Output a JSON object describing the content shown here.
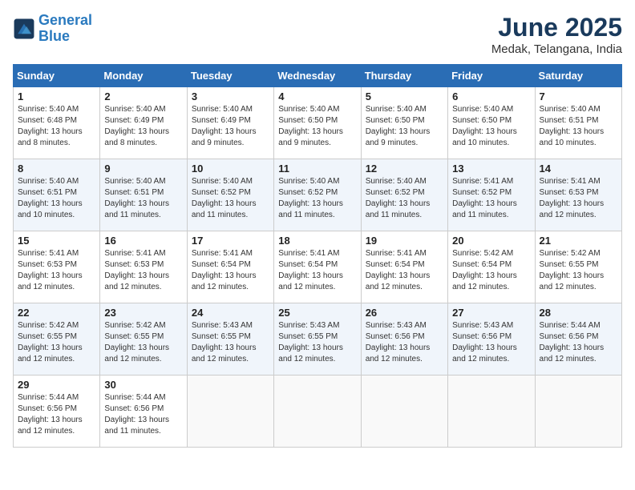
{
  "header": {
    "logo_line1": "General",
    "logo_line2": "Blue",
    "month": "June 2025",
    "location": "Medak, Telangana, India"
  },
  "weekdays": [
    "Sunday",
    "Monday",
    "Tuesday",
    "Wednesday",
    "Thursday",
    "Friday",
    "Saturday"
  ],
  "weeks": [
    [
      {
        "day": "1",
        "info": "Sunrise: 5:40 AM\nSunset: 6:48 PM\nDaylight: 13 hours\nand 8 minutes."
      },
      {
        "day": "2",
        "info": "Sunrise: 5:40 AM\nSunset: 6:49 PM\nDaylight: 13 hours\nand 8 minutes."
      },
      {
        "day": "3",
        "info": "Sunrise: 5:40 AM\nSunset: 6:49 PM\nDaylight: 13 hours\nand 9 minutes."
      },
      {
        "day": "4",
        "info": "Sunrise: 5:40 AM\nSunset: 6:50 PM\nDaylight: 13 hours\nand 9 minutes."
      },
      {
        "day": "5",
        "info": "Sunrise: 5:40 AM\nSunset: 6:50 PM\nDaylight: 13 hours\nand 9 minutes."
      },
      {
        "day": "6",
        "info": "Sunrise: 5:40 AM\nSunset: 6:50 PM\nDaylight: 13 hours\nand 10 minutes."
      },
      {
        "day": "7",
        "info": "Sunrise: 5:40 AM\nSunset: 6:51 PM\nDaylight: 13 hours\nand 10 minutes."
      }
    ],
    [
      {
        "day": "8",
        "info": "Sunrise: 5:40 AM\nSunset: 6:51 PM\nDaylight: 13 hours\nand 10 minutes."
      },
      {
        "day": "9",
        "info": "Sunrise: 5:40 AM\nSunset: 6:51 PM\nDaylight: 13 hours\nand 11 minutes."
      },
      {
        "day": "10",
        "info": "Sunrise: 5:40 AM\nSunset: 6:52 PM\nDaylight: 13 hours\nand 11 minutes."
      },
      {
        "day": "11",
        "info": "Sunrise: 5:40 AM\nSunset: 6:52 PM\nDaylight: 13 hours\nand 11 minutes."
      },
      {
        "day": "12",
        "info": "Sunrise: 5:40 AM\nSunset: 6:52 PM\nDaylight: 13 hours\nand 11 minutes."
      },
      {
        "day": "13",
        "info": "Sunrise: 5:41 AM\nSunset: 6:52 PM\nDaylight: 13 hours\nand 11 minutes."
      },
      {
        "day": "14",
        "info": "Sunrise: 5:41 AM\nSunset: 6:53 PM\nDaylight: 13 hours\nand 12 minutes."
      }
    ],
    [
      {
        "day": "15",
        "info": "Sunrise: 5:41 AM\nSunset: 6:53 PM\nDaylight: 13 hours\nand 12 minutes."
      },
      {
        "day": "16",
        "info": "Sunrise: 5:41 AM\nSunset: 6:53 PM\nDaylight: 13 hours\nand 12 minutes."
      },
      {
        "day": "17",
        "info": "Sunrise: 5:41 AM\nSunset: 6:54 PM\nDaylight: 13 hours\nand 12 minutes."
      },
      {
        "day": "18",
        "info": "Sunrise: 5:41 AM\nSunset: 6:54 PM\nDaylight: 13 hours\nand 12 minutes."
      },
      {
        "day": "19",
        "info": "Sunrise: 5:41 AM\nSunset: 6:54 PM\nDaylight: 13 hours\nand 12 minutes."
      },
      {
        "day": "20",
        "info": "Sunrise: 5:42 AM\nSunset: 6:54 PM\nDaylight: 13 hours\nand 12 minutes."
      },
      {
        "day": "21",
        "info": "Sunrise: 5:42 AM\nSunset: 6:55 PM\nDaylight: 13 hours\nand 12 minutes."
      }
    ],
    [
      {
        "day": "22",
        "info": "Sunrise: 5:42 AM\nSunset: 6:55 PM\nDaylight: 13 hours\nand 12 minutes."
      },
      {
        "day": "23",
        "info": "Sunrise: 5:42 AM\nSunset: 6:55 PM\nDaylight: 13 hours\nand 12 minutes."
      },
      {
        "day": "24",
        "info": "Sunrise: 5:43 AM\nSunset: 6:55 PM\nDaylight: 13 hours\nand 12 minutes."
      },
      {
        "day": "25",
        "info": "Sunrise: 5:43 AM\nSunset: 6:55 PM\nDaylight: 13 hours\nand 12 minutes."
      },
      {
        "day": "26",
        "info": "Sunrise: 5:43 AM\nSunset: 6:56 PM\nDaylight: 13 hours\nand 12 minutes."
      },
      {
        "day": "27",
        "info": "Sunrise: 5:43 AM\nSunset: 6:56 PM\nDaylight: 13 hours\nand 12 minutes."
      },
      {
        "day": "28",
        "info": "Sunrise: 5:44 AM\nSunset: 6:56 PM\nDaylight: 13 hours\nand 12 minutes."
      }
    ],
    [
      {
        "day": "29",
        "info": "Sunrise: 5:44 AM\nSunset: 6:56 PM\nDaylight: 13 hours\nand 12 minutes."
      },
      {
        "day": "30",
        "info": "Sunrise: 5:44 AM\nSunset: 6:56 PM\nDaylight: 13 hours\nand 11 minutes."
      },
      {
        "day": "",
        "info": ""
      },
      {
        "day": "",
        "info": ""
      },
      {
        "day": "",
        "info": ""
      },
      {
        "day": "",
        "info": ""
      },
      {
        "day": "",
        "info": ""
      }
    ]
  ]
}
